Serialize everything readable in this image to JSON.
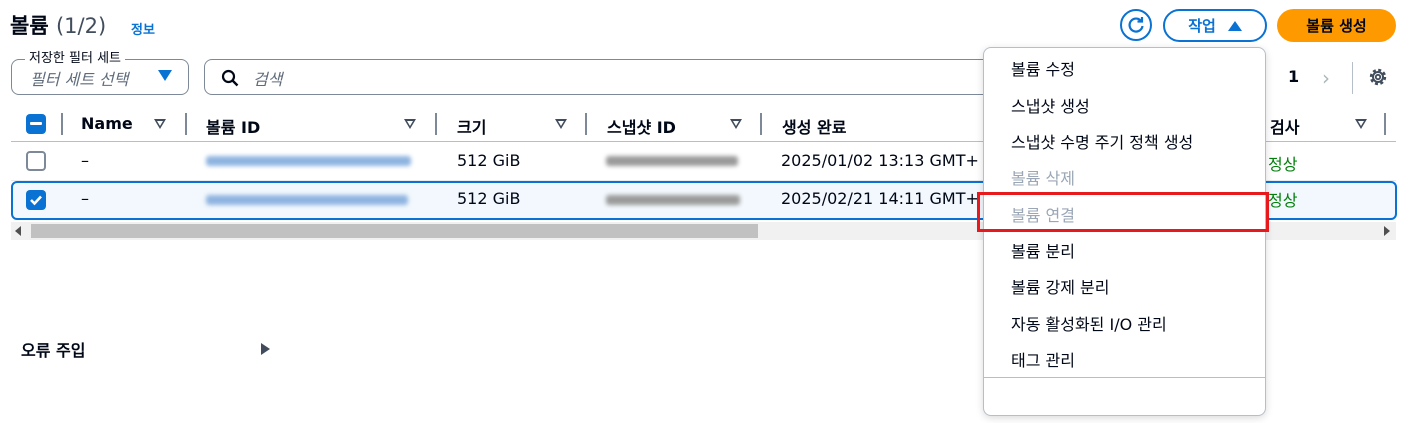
{
  "header": {
    "title": "볼륨",
    "count": "(1/2)",
    "info_link": "정보",
    "actions_label": "작업",
    "create_label": "볼륨 생성"
  },
  "filters": {
    "filter_set_label": "저장한 필터 세트",
    "filter_set_placeholder": "필터 세트 선택",
    "search_placeholder": "검색"
  },
  "pagination": {
    "current_page": "1"
  },
  "table": {
    "columns": [
      "Name",
      "볼륨 ID",
      "크기",
      "스냅샷 ID",
      "생성 완료",
      "검사"
    ],
    "rows": [
      {
        "selected": false,
        "name": "–",
        "size": "512 GiB",
        "created": "2025/01/02 13:13 GMT+",
        "status": "정상"
      },
      {
        "selected": true,
        "name": "–",
        "size": "512 GiB",
        "created": "2025/02/21 14:11 GMT+",
        "status": "정상"
      }
    ]
  },
  "actions_menu": {
    "items": [
      {
        "label": "볼륨 수정",
        "disabled": false
      },
      {
        "label": "스냅샷 생성",
        "disabled": false
      },
      {
        "label": "스냅샷 수명 주기 정책 생성",
        "disabled": false
      },
      {
        "label": "볼륨 삭제",
        "disabled": true
      },
      {
        "label": "볼륨 연결",
        "disabled": true
      },
      {
        "label": "볼륨 분리",
        "disabled": false
      },
      {
        "label": "볼륨 강제 분리",
        "disabled": false
      },
      {
        "label": "자동 활성화된 I/O 관리",
        "disabled": false
      },
      {
        "label": "태그 관리",
        "disabled": false
      }
    ],
    "group_label": "오류 주입"
  },
  "colors": {
    "primary": "#0972d3",
    "create_button": "#ff9900",
    "status_ok": "#037f0c",
    "highlight": "#e8191c"
  },
  "icons": [
    "refresh-icon",
    "caret-up-icon",
    "caret-down-icon",
    "search-icon",
    "chevron-right-icon",
    "settings-icon",
    "sort-icon",
    "checkbox-icon",
    "submenu-arrow-icon"
  ]
}
